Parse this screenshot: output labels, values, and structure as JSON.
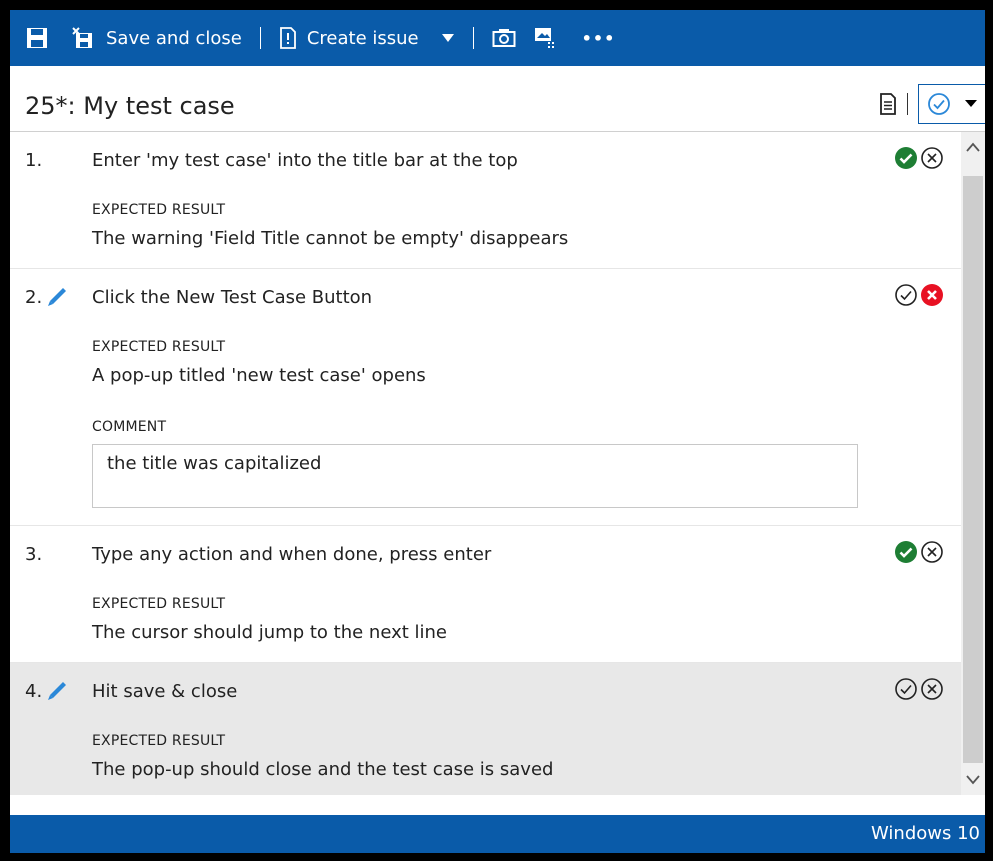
{
  "toolbar": {
    "save_close_label": "Save and close",
    "create_issue_label": "Create issue",
    "more_label": "•••"
  },
  "title": "25*: My test case",
  "steps": [
    {
      "number": "1.",
      "action": "Enter 'my test case' into the title bar at the top",
      "expected_label": "EXPECTED RESULT",
      "expected": "The warning 'Field Title cannot be empty' disappears",
      "status": "passed",
      "selected": false
    },
    {
      "number": "2.",
      "action": "Click the New Test Case Button",
      "expected_label": "EXPECTED RESULT",
      "expected": "A pop-up titled 'new test case' opens",
      "comment_label": "COMMENT",
      "comment": "the title was capitalized",
      "status": "failed",
      "selected": false
    },
    {
      "number": "3.",
      "action": "Type any action and when done, press enter",
      "expected_label": "EXPECTED RESULT",
      "expected": "The cursor should jump to the next line",
      "status": "passed",
      "selected": false
    },
    {
      "number": "4.",
      "action": "Hit save & close",
      "expected_label": "EXPECTED RESULT",
      "expected": "The pop-up should close and the test case is saved",
      "status": "none",
      "selected": true
    }
  ],
  "footer": {
    "label": "Windows 10"
  },
  "colors": {
    "brand": "#0a5ba9",
    "pass": "#1e7e34",
    "fail": "#e81123",
    "selected_row": "#e8e8e8"
  }
}
